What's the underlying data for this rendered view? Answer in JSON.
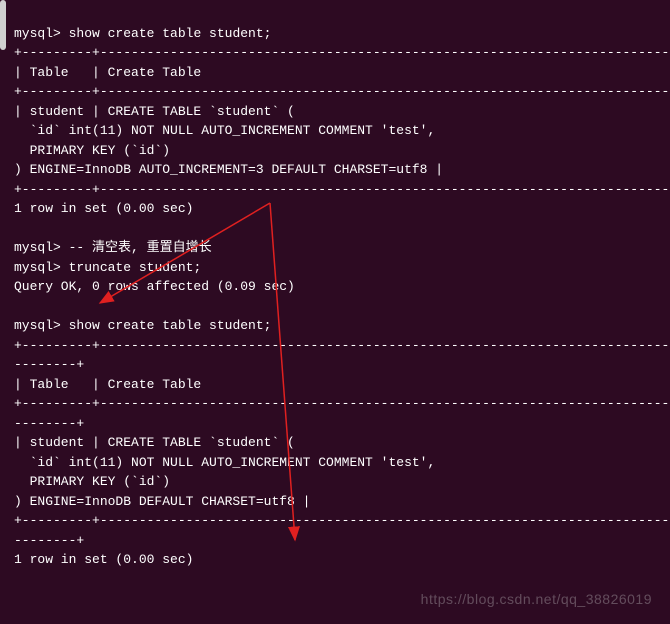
{
  "prompt": "mysql>",
  "commands": {
    "show_create_1": "show create table student;",
    "comment": "-- 清空表, 重置自增长",
    "truncate": "truncate student;",
    "show_create_2": "show create table student;"
  },
  "separators": {
    "long": "+---------+-------------------------------------------------------------------------------------------------------------------------------------------+",
    "header_row": "| Table   | Create Table                                                                                                     |",
    "short": "+---------+-------------------------------------------------------------------------------------------------------------------------------------------+",
    "small_sep": "--------+",
    "header_row_2": "| Table   | Create Table                                                                                                     |         |"
  },
  "table_content_1": {
    "line1": "| student | CREATE TABLE `student` (",
    "line2": "  `id` int(11) NOT NULL AUTO_INCREMENT COMMENT 'test',",
    "line3": "  PRIMARY KEY (`id`)",
    "line4": ") ENGINE=InnoDB AUTO_INCREMENT=3 DEFAULT CHARSET=utf8 |"
  },
  "table_content_2": {
    "line1": "| student | CREATE TABLE `student` (",
    "line2": "  `id` int(11) NOT NULL AUTO_INCREMENT COMMENT 'test',",
    "line3": "  PRIMARY KEY (`id`)",
    "line4": ") ENGINE=InnoDB DEFAULT CHARSET=utf8 |"
  },
  "results": {
    "row_set_1": "1 row in set (0.00 sec)",
    "query_ok": "Query OK, 0 rows affected (0.09 sec)",
    "row_set_2": "1 row in set (0.00 sec)"
  },
  "watermark": "https://blog.csdn.net/qq_38826019",
  "annotation_arrows": {
    "description": "Two red arrows pointing from AUTO_INCREMENT=3 in first result down toward the second CREATE TABLE result showing AUTO_INCREMENT reset after truncate",
    "color": "#e02020"
  }
}
